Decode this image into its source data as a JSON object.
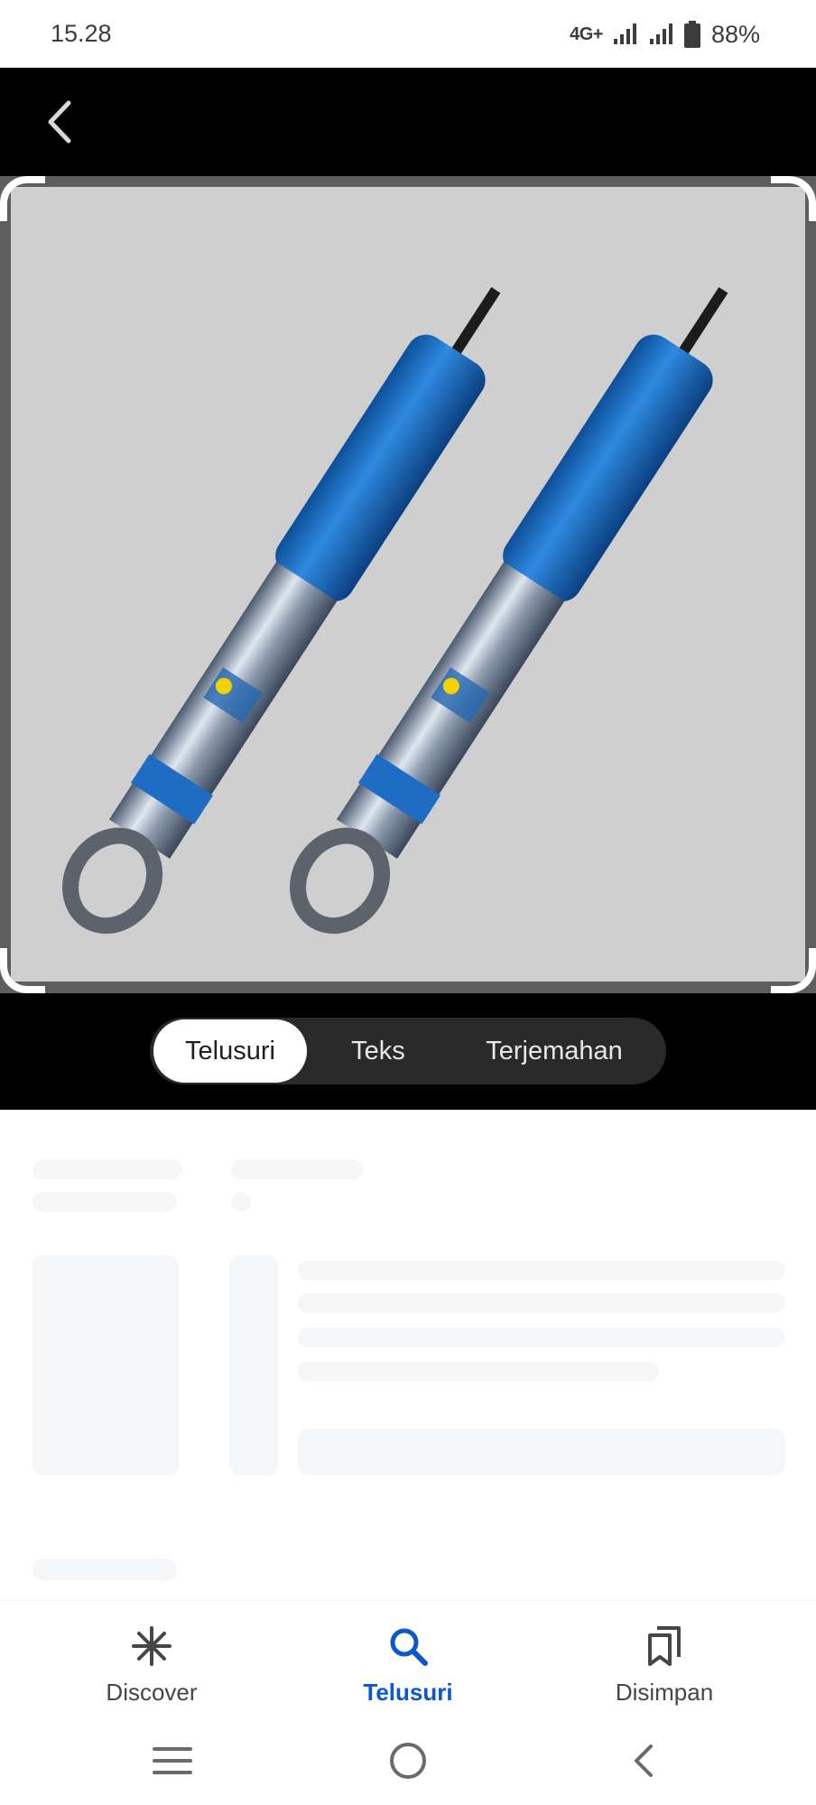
{
  "status_bar": {
    "time": "15.28",
    "network": "4G+",
    "battery_percent": "88%"
  },
  "lens": {
    "back_icon": "chevron-left-icon",
    "image_description_icon": "shock-absorber-pair-image",
    "mode_tabs": [
      {
        "label": "Telusuri",
        "active": true
      },
      {
        "label": "Teks",
        "active": false
      },
      {
        "label": "Terjemahan",
        "active": false
      }
    ]
  },
  "bottom_nav": {
    "items": [
      {
        "label": "Discover",
        "icon": "asterisk-icon",
        "active": false
      },
      {
        "label": "Telusuri",
        "icon": "search-icon",
        "active": true
      },
      {
        "label": "Disimpan",
        "icon": "bookmarks-icon",
        "active": false
      }
    ]
  },
  "system_nav": {
    "icons": [
      "recents-icon",
      "home-icon",
      "back-icon"
    ]
  },
  "colors": {
    "active_blue": "#0b57d0",
    "shock_blue": "#1e78d0",
    "panel_gray": "#cfcfcf"
  }
}
